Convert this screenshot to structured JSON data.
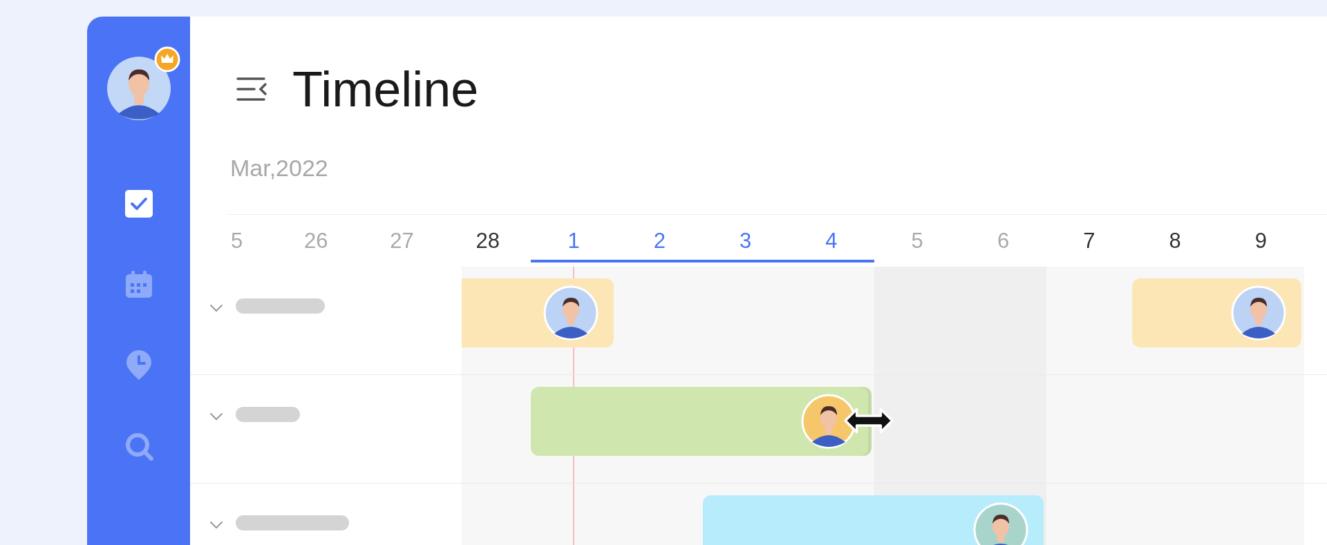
{
  "sidebar": {
    "user": {
      "avatar": {
        "color": "#c3d7f6"
      },
      "premium": true
    },
    "items": [
      {
        "kind": "tasks",
        "selected": true
      },
      {
        "kind": "calendar",
        "selected": false
      },
      {
        "kind": "time",
        "selected": false
      },
      {
        "kind": "search",
        "selected": false
      }
    ]
  },
  "header": {
    "title": "Timeline",
    "month": "Mar,2022"
  },
  "dates": [
    {
      "label": "5",
      "muted": true,
      "selected": false,
      "today": false
    },
    {
      "label": "26",
      "muted": true,
      "selected": false,
      "today": false
    },
    {
      "label": "27",
      "muted": true,
      "selected": false,
      "today": false
    },
    {
      "label": "28",
      "muted": false,
      "selected": false,
      "today": false
    },
    {
      "label": "1",
      "muted": false,
      "selected": true,
      "today": true
    },
    {
      "label": "2",
      "muted": false,
      "selected": true,
      "today": false
    },
    {
      "label": "3",
      "muted": false,
      "selected": true,
      "today": false
    },
    {
      "label": "4",
      "muted": false,
      "selected": true,
      "today": false
    },
    {
      "label": "5",
      "muted": true,
      "selected": false,
      "today": false
    },
    {
      "label": "6",
      "muted": true,
      "selected": false,
      "today": false
    },
    {
      "label": "7",
      "muted": false,
      "selected": false,
      "today": false
    },
    {
      "label": "8",
      "muted": false,
      "selected": false,
      "today": false
    },
    {
      "label": "9",
      "muted": false,
      "selected": false,
      "today": false
    }
  ],
  "rows": [
    {
      "expanded": true,
      "bars": [
        {
          "color": "#fde6b6",
          "avatar": {
            "color": "#bcd3f5"
          },
          "resizing": false
        },
        {
          "color": "#fde6b6",
          "avatar": {
            "color": "#bcd3f5"
          },
          "resizing": false
        }
      ]
    },
    {
      "expanded": true,
      "bars": [
        {
          "color": "#cfe7ae",
          "avatar": {
            "color": "#f5c76a"
          },
          "resizing": true
        }
      ]
    },
    {
      "expanded": true,
      "bars": [
        {
          "color": "#b6ecfb",
          "avatar": {
            "color": "#a9d4cb"
          }
        }
      ]
    }
  ]
}
